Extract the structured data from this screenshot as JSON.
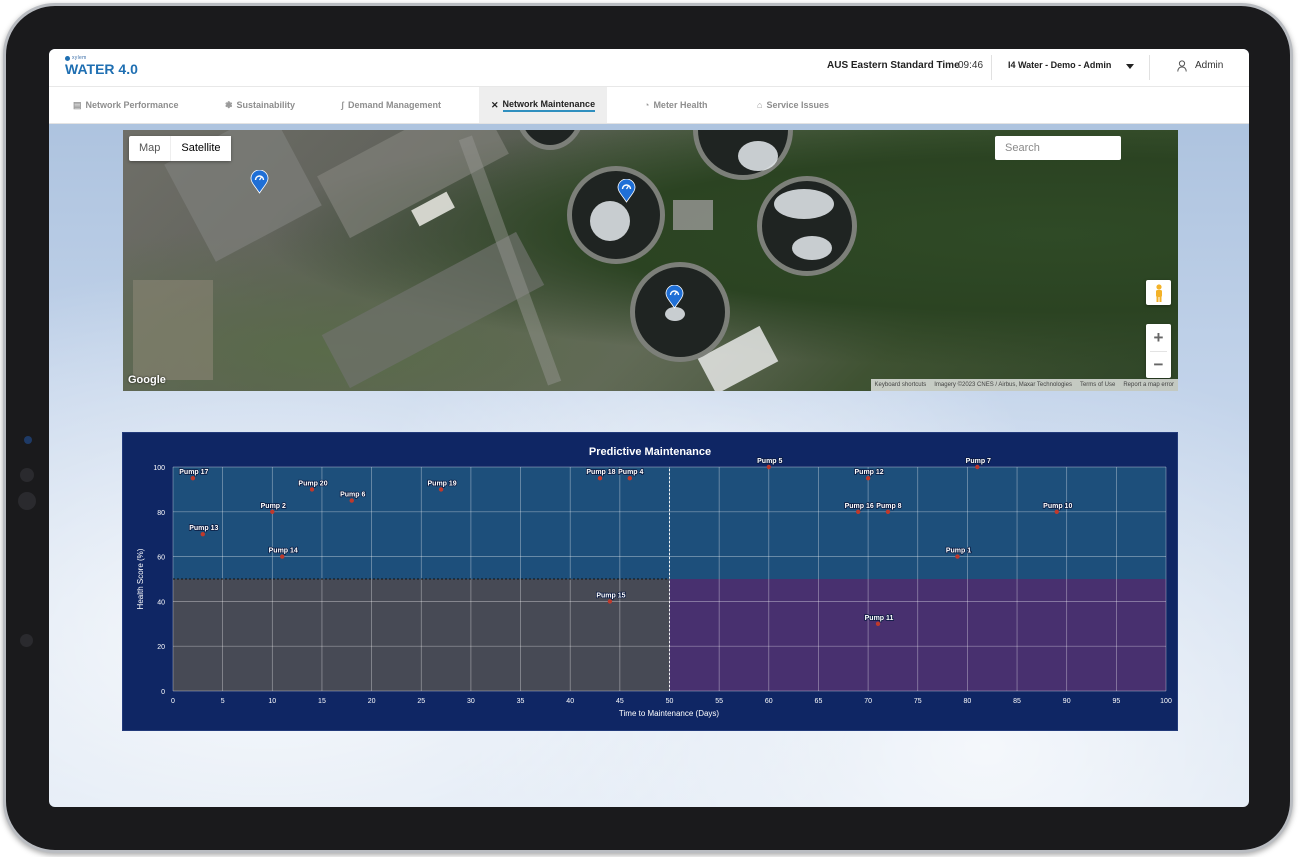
{
  "header": {
    "logo_small": "xylem",
    "logo_main": "WATER 4.0",
    "timezone_label": "AUS Eastern Standard Time",
    "time": "09:46",
    "org_selector": "I4 Water - Demo - Admin",
    "user_name": "Admin"
  },
  "nav": {
    "tabs": [
      {
        "label": "Network Performance",
        "icon": "chart-icon",
        "active": false
      },
      {
        "label": "Sustainability",
        "icon": "gear-icon",
        "active": false
      },
      {
        "label": "Demand Management",
        "icon": "pipe-icon",
        "active": false
      },
      {
        "label": "Network Maintenance",
        "icon": "tools-icon",
        "active": true
      },
      {
        "label": "Meter Health",
        "icon": "gauge-icon",
        "active": false
      },
      {
        "label": "Service Issues",
        "icon": "warning-icon",
        "active": false
      }
    ]
  },
  "map": {
    "type_map": "Map",
    "type_satellite": "Satellite",
    "selected_type": "Satellite",
    "search_placeholder": "Search",
    "google_label": "Google",
    "attribution": {
      "shortcuts": "Keyboard shortcuts",
      "imagery": "Imagery ©2023 CNES / Airbus, Maxar Technologies",
      "terms": "Terms of Use",
      "report": "Report a map error"
    },
    "zoom_in": "+",
    "zoom_out": "−",
    "pin_color": "#1f6fd6"
  },
  "chart_data": {
    "type": "scatter",
    "title": "Predictive Maintenance",
    "xlabel": "Time to Maintenance (Days)",
    "ylabel": "Health Score (%)",
    "xlim": [
      0,
      100
    ],
    "ylim": [
      0,
      100
    ],
    "xticks": [
      0,
      5,
      10,
      15,
      20,
      25,
      30,
      35,
      40,
      45,
      50,
      55,
      60,
      65,
      70,
      75,
      80,
      85,
      90,
      95,
      100
    ],
    "yticks": [
      0,
      20,
      40,
      60,
      80,
      100
    ],
    "threshold_x": 50,
    "threshold_y": 50,
    "grid": true,
    "zone_colors": {
      "healthy": "#1d4f7b",
      "low_health_near": "#474a55",
      "low_health_far": "#48306f"
    },
    "point_color": "#c0392b",
    "points": [
      {
        "name": "Pump 17",
        "x": 2,
        "y": 95
      },
      {
        "name": "Pump 20",
        "x": 14,
        "y": 90
      },
      {
        "name": "Pump 6",
        "x": 18,
        "y": 85
      },
      {
        "name": "Pump 2",
        "x": 10,
        "y": 80
      },
      {
        "name": "Pump 13",
        "x": 3,
        "y": 70
      },
      {
        "name": "Pump 14",
        "x": 11,
        "y": 60
      },
      {
        "name": "Pump 19",
        "x": 27,
        "y": 90
      },
      {
        "name": "Pump 18",
        "x": 43,
        "y": 95
      },
      {
        "name": "Pump 4",
        "x": 46,
        "y": 95
      },
      {
        "name": "Pump 15",
        "x": 44,
        "y": 40
      },
      {
        "name": "Pump 5",
        "x": 60,
        "y": 100
      },
      {
        "name": "Pump 12",
        "x": 70,
        "y": 95
      },
      {
        "name": "Pump 16",
        "x": 69,
        "y": 80
      },
      {
        "name": "Pump 8",
        "x": 72,
        "y": 80
      },
      {
        "name": "Pump 7",
        "x": 81,
        "y": 100
      },
      {
        "name": "Pump 10",
        "x": 89,
        "y": 80
      },
      {
        "name": "Pump 1",
        "x": 79,
        "y": 60
      },
      {
        "name": "Pump 11",
        "x": 71,
        "y": 30
      }
    ]
  }
}
